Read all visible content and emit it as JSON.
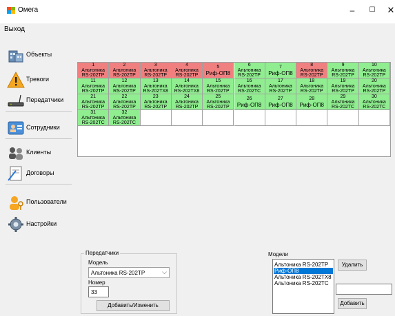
{
  "window": {
    "title": "Омега",
    "min_label": "–",
    "max_label": "☐",
    "close_label": "✕"
  },
  "menu": {
    "exit_label": "Выход"
  },
  "sidebar": {
    "items": [
      {
        "label": "Объекты",
        "icon": "buildings-icon"
      },
      {
        "label": "Тревоги",
        "icon": "warning-icon"
      },
      {
        "label": "Передатчики",
        "icon": "transmitter-icon"
      },
      {
        "label": "Сотрудники",
        "icon": "employee-card-icon"
      },
      {
        "label": "Клиенты",
        "icon": "clients-icon"
      },
      {
        "label": "Договоры",
        "icon": "contract-icon"
      },
      {
        "label": "Пользователи",
        "icon": "users-key-icon"
      },
      {
        "label": "Настройки",
        "icon": "settings-icon"
      }
    ]
  },
  "grid": {
    "colors": {
      "green": "#90ee90",
      "red": "#f08080",
      "empty": "#ffffff"
    },
    "cells": [
      {
        "num": "1",
        "line1": "Альтоника",
        "line2": "RS-202TP",
        "status": "red"
      },
      {
        "num": "2",
        "line1": "Альтоника",
        "line2": "RS-202TP",
        "status": "red"
      },
      {
        "num": "3",
        "line1": "Альтоника",
        "line2": "RS-202TP",
        "status": "red"
      },
      {
        "num": "4",
        "line1": "Альтоника",
        "line2": "RS-202TP",
        "status": "red"
      },
      {
        "num": "5",
        "line1": "Риф-ОП8",
        "line2": "",
        "status": "red"
      },
      {
        "num": "6",
        "line1": "Альтоника",
        "line2": "RS-202TP",
        "status": "green"
      },
      {
        "num": "7",
        "line1": "Риф-ОП8",
        "line2": "",
        "status": "green"
      },
      {
        "num": "8",
        "line1": "Альтоника",
        "line2": "RS-202TP",
        "status": "red"
      },
      {
        "num": "9",
        "line1": "Альтоника",
        "line2": "RS-202TP",
        "status": "green"
      },
      {
        "num": "10",
        "line1": "Альтоника",
        "line2": "RS-202TP",
        "status": "green"
      },
      {
        "num": "11",
        "line1": "Альтоника",
        "line2": "RS-202TP",
        "status": "green"
      },
      {
        "num": "12",
        "line1": "Альтоника",
        "line2": "RS-202TP",
        "status": "green"
      },
      {
        "num": "13",
        "line1": "Альтоника",
        "line2": "RS-202TX8",
        "status": "green"
      },
      {
        "num": "14",
        "line1": "Альтоника",
        "line2": "RS-202TX8",
        "status": "green"
      },
      {
        "num": "15",
        "line1": "Альтоника",
        "line2": "RS-202TP",
        "status": "green"
      },
      {
        "num": "16",
        "line1": "Альтоника",
        "line2": "RS-202TC",
        "status": "green"
      },
      {
        "num": "17",
        "line1": "Альтоника",
        "line2": "RS-202TP",
        "status": "green"
      },
      {
        "num": "18",
        "line1": "Альтоника",
        "line2": "RS-202TP",
        "status": "green"
      },
      {
        "num": "19",
        "line1": "Альтоника",
        "line2": "RS-202TP",
        "status": "green"
      },
      {
        "num": "20",
        "line1": "Альтоника",
        "line2": "RS-202TP",
        "status": "green"
      },
      {
        "num": "21",
        "line1": "Альтоника",
        "line2": "RS-202TP",
        "status": "green"
      },
      {
        "num": "22",
        "line1": "Альтоника",
        "line2": "RS-202TP",
        "status": "green"
      },
      {
        "num": "23",
        "line1": "Альтоника",
        "line2": "RS-202TP",
        "status": "green"
      },
      {
        "num": "24",
        "line1": "Альтоника",
        "line2": "RS-202TP",
        "status": "green"
      },
      {
        "num": "25",
        "line1": "Альтоника",
        "line2": "RS-202TP",
        "status": "green"
      },
      {
        "num": "26",
        "line1": "Риф-ОП8",
        "line2": "",
        "status": "green"
      },
      {
        "num": "27",
        "line1": "Риф-ОП8",
        "line2": "",
        "status": "green"
      },
      {
        "num": "28",
        "line1": "Риф-ОП8",
        "line2": "",
        "status": "green"
      },
      {
        "num": "29",
        "line1": "Альтоника",
        "line2": "RS-202TC",
        "status": "green"
      },
      {
        "num": "30",
        "line1": "Альтоника",
        "line2": "RS-202TC",
        "status": "green"
      },
      {
        "num": "31",
        "line1": "Альтоника",
        "line2": "RS-202TC",
        "status": "green"
      },
      {
        "num": "32",
        "line1": "Альтоника",
        "line2": "RS-202TC",
        "status": "green"
      },
      {
        "num": "",
        "line1": "",
        "line2": "",
        "status": "empty"
      },
      {
        "num": "",
        "line1": "",
        "line2": "",
        "status": "empty"
      },
      {
        "num": "",
        "line1": "",
        "line2": "",
        "status": "empty"
      },
      {
        "num": "",
        "line1": "",
        "line2": "",
        "status": "empty"
      },
      {
        "num": "",
        "line1": "",
        "line2": "",
        "status": "empty"
      },
      {
        "num": "",
        "line1": "",
        "line2": "",
        "status": "empty"
      },
      {
        "num": "",
        "line1": "",
        "line2": "",
        "status": "empty"
      },
      {
        "num": "",
        "line1": "",
        "line2": "",
        "status": "empty"
      }
    ]
  },
  "transmitters": {
    "group_title": "Передатчики",
    "model_label": "Модель",
    "model_value": "Альтоника RS-202TP",
    "number_label": "Номер",
    "number_value": "33",
    "save_button": "Добавить/Изменить"
  },
  "models": {
    "group_title": "Модели",
    "items": [
      {
        "label": "Альтоника RS-202TP",
        "selected": false
      },
      {
        "label": "Риф-ОП8",
        "selected": true
      },
      {
        "label": "Альтоника RS-202TX8",
        "selected": false
      },
      {
        "label": "Альтоника RS-202TC",
        "selected": false
      }
    ],
    "delete_button": "Удалить",
    "new_model_value": "",
    "add_button": "Добавить"
  }
}
